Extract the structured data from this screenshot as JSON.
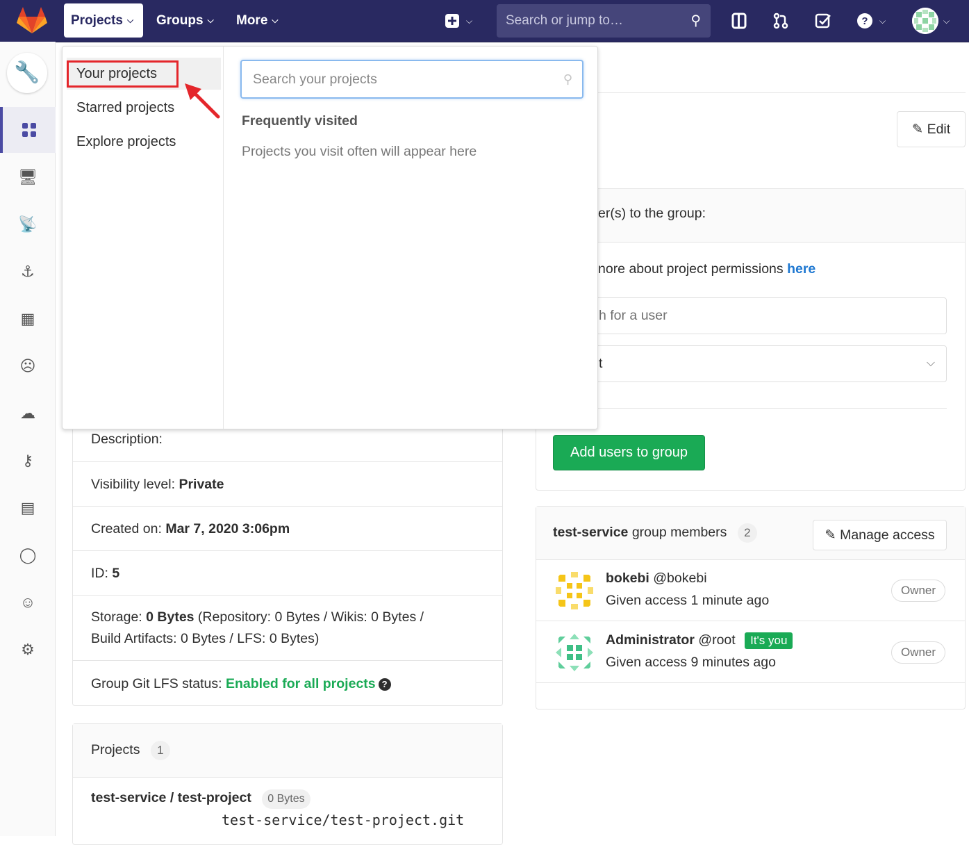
{
  "nav": {
    "projects": "Projects",
    "groups": "Groups",
    "more": "More",
    "search_placeholder": "Search or jump to…"
  },
  "dropdown": {
    "items": [
      "Your projects",
      "Starred projects",
      "Explore projects"
    ],
    "search_placeholder": "Search your projects",
    "frequent_title": "Frequently visited",
    "frequent_empty": "Projects you visit often will appear here"
  },
  "main": {
    "edit_label": "Edit",
    "add_header_fragment": "er(s) to the group:",
    "perm_text_fragment": "nore about project permissions",
    "perm_link": "here",
    "user_search_fragment": "h for a user",
    "role_select_fragment": "t",
    "add_users_button": "Add users to group"
  },
  "group_info": {
    "description_label": "Description:",
    "visibility_label": "Visibility level:",
    "visibility_value": "Private",
    "created_label": "Created on:",
    "created_value": "Mar 7, 2020 3:06pm",
    "id_label": "ID:",
    "id_value": "5",
    "storage_label": "Storage:",
    "storage_value": "0 Bytes",
    "storage_detail_1": " (Repository: 0 Bytes / Wikis: 0 Bytes /",
    "storage_detail_2": "Build Artifacts: 0 Bytes / LFS: 0 Bytes)",
    "lfs_label": "Group Git LFS status:",
    "lfs_value": "Enabled for all projects"
  },
  "projects_card": {
    "title": "Projects",
    "count": "1",
    "project_name": "test-service / test-project",
    "project_size": "0 Bytes",
    "project_path": "test-service/test-project.git"
  },
  "members_card": {
    "group_name": "test-service",
    "title_suffix": "group members",
    "count": "2",
    "manage_label": "Manage access",
    "members": [
      {
        "name": "bokebi",
        "username": "@bokebi",
        "access": "Given access 1 minute ago",
        "role": "Owner"
      },
      {
        "name": "Administrator",
        "username": "@root",
        "badge": "It's you",
        "access": "Given access 9 minutes ago",
        "role": "Owner"
      }
    ]
  },
  "colors": {
    "nav_bg": "#292961",
    "green": "#1aaa55",
    "link_blue": "#1f78d1",
    "highlight_red": "#e4262b"
  }
}
